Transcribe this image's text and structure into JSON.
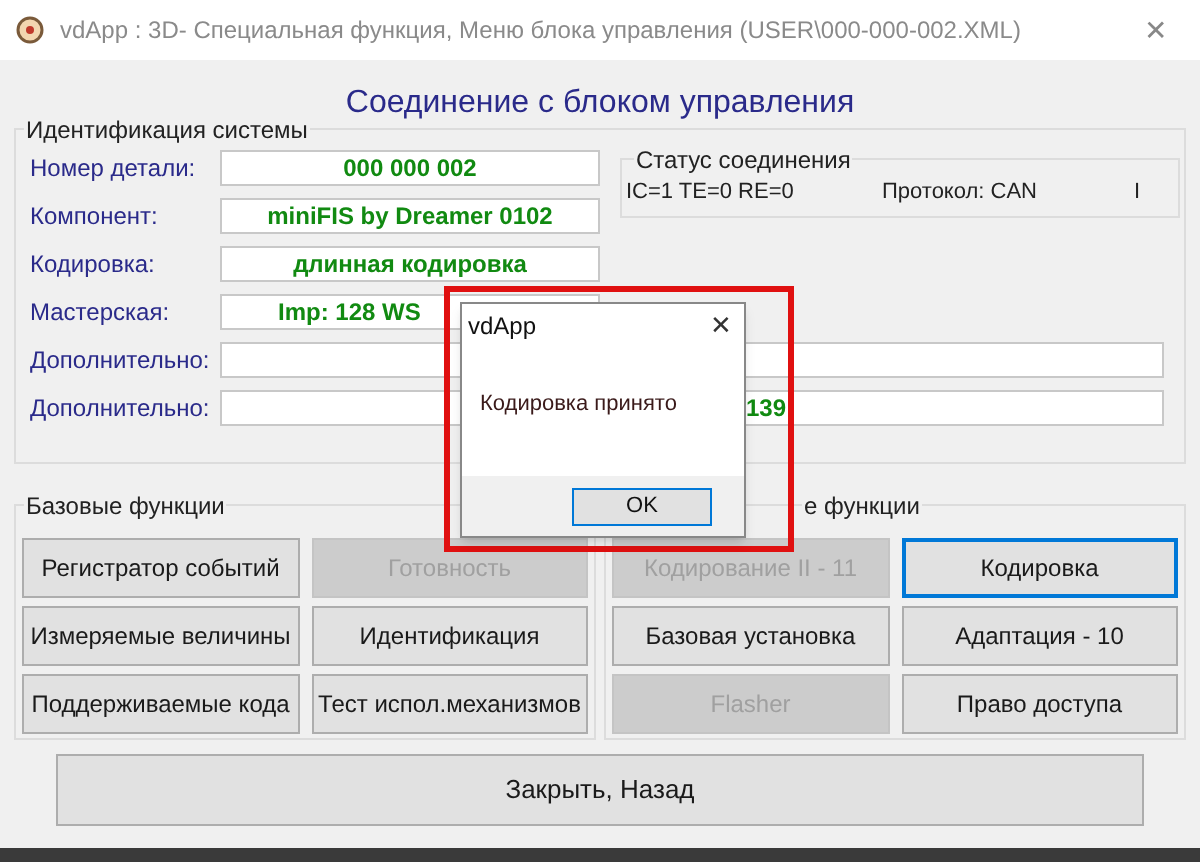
{
  "window": {
    "title": "vdApp : 3D- Специальная функция,  Меню блока управления (USER\\000-000-002.XML)",
    "close": "✕"
  },
  "heading": "Соединение с блоком управления",
  "identification": {
    "title": "Идентификация системы",
    "fields": [
      {
        "label": "Номер детали:",
        "value": "000 000 002"
      },
      {
        "label": "Компонент:",
        "value": "miniFIS by Dreamer  0102"
      },
      {
        "label": "Кодировка:",
        "value": "длинная кодировка"
      },
      {
        "label": "Мастерская:",
        "value": "Imp: 128     WS"
      },
      {
        "label": "Дополнительно:"
      },
      {
        "label": "Дополнительно:",
        "value": "139"
      }
    ]
  },
  "status": {
    "title": "Статус соединения",
    "items": [
      "IC=1  TE=0   RE=0",
      "Протокол: CAN",
      "I"
    ]
  },
  "basic_functions": {
    "title": "Базовые функции",
    "buttons": [
      {
        "label": "Регистратор событий",
        "disabled": false,
        "focused": false
      },
      {
        "label": "Готовность",
        "disabled": true,
        "focused": false
      },
      {
        "label": "Измеряемые величины",
        "disabled": false,
        "focused": false
      },
      {
        "label": "Идентификация",
        "disabled": false,
        "focused": false
      },
      {
        "label": "Поддерживаемые кода",
        "disabled": false,
        "focused": false
      },
      {
        "label": "Тест испол.механизмов",
        "disabled": false,
        "focused": false
      }
    ]
  },
  "special_functions": {
    "title": "е функции",
    "buttons": [
      {
        "label": "Кодирование II - 11",
        "disabled": true,
        "focused": false
      },
      {
        "label": "Кодировка",
        "disabled": false,
        "focused": true
      },
      {
        "label": "Базовая установка",
        "disabled": false,
        "focused": false
      },
      {
        "label": "Адаптация - 10",
        "disabled": false,
        "focused": false
      },
      {
        "label": "Flasher",
        "disabled": true,
        "focused": false
      },
      {
        "label": "Право доступа",
        "disabled": false,
        "focused": false
      }
    ]
  },
  "close_button": "Закрыть, Назад",
  "dialog": {
    "title": "vdApp",
    "close": "✕",
    "message": "Кодировка принято",
    "ok": "OK"
  }
}
